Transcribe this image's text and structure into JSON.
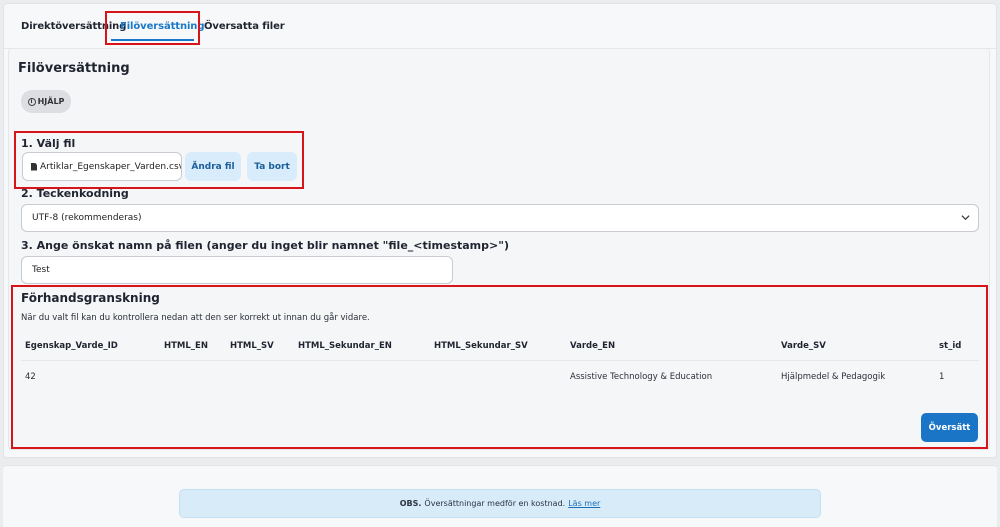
{
  "tabs": [
    {
      "label": "Direktöversättning",
      "active": false
    },
    {
      "label": "Filöversättning",
      "active": true
    },
    {
      "label": "Översatta filer",
      "active": false
    }
  ],
  "section_title": "Filöversättning",
  "help_button": {
    "icon": "info-icon",
    "label": "HJÄLP"
  },
  "step1": {
    "label": "1. Välj fil",
    "file_icon": "document-icon",
    "file_name": "Artiklar_Egenskaper_Varden.csv",
    "change_button": "Ändra fil",
    "remove_button": "Ta bort"
  },
  "step2": {
    "label": "2. Teckenkodning",
    "selected": "UTF-8 (rekommenderas)",
    "chevron_icon": "chevron-down-icon"
  },
  "step3": {
    "label": "3. Ange önskat namn på filen (anger du inget blir namnet \"file_<timestamp>\")",
    "value": "Test"
  },
  "preview": {
    "title": "Förhandsgranskning",
    "description": "När du valt fil kan du kontrollera nedan att den ser korrekt ut innan du går vidare.",
    "columns": [
      "Egenskap_Varde_ID",
      "HTML_EN",
      "HTML_SV",
      "HTML_Sekundar_EN",
      "HTML_Sekundar_SV",
      "Varde_EN",
      "Varde_SV",
      "st_id"
    ],
    "rows": [
      [
        "42",
        "",
        "",
        "",
        "",
        "Assistive Technology & Education",
        "Hjälpmedel & Pedagogik",
        "1"
      ]
    ]
  },
  "translate_button": "Översätt",
  "notice": {
    "bold": "OBS.",
    "text": "Översättningar medför en kostnad.",
    "link": "Läs mer",
    "background": "#d7ecf8"
  },
  "colors": {
    "accent": "#1a75c6",
    "annotation_box": "#d8141b"
  }
}
